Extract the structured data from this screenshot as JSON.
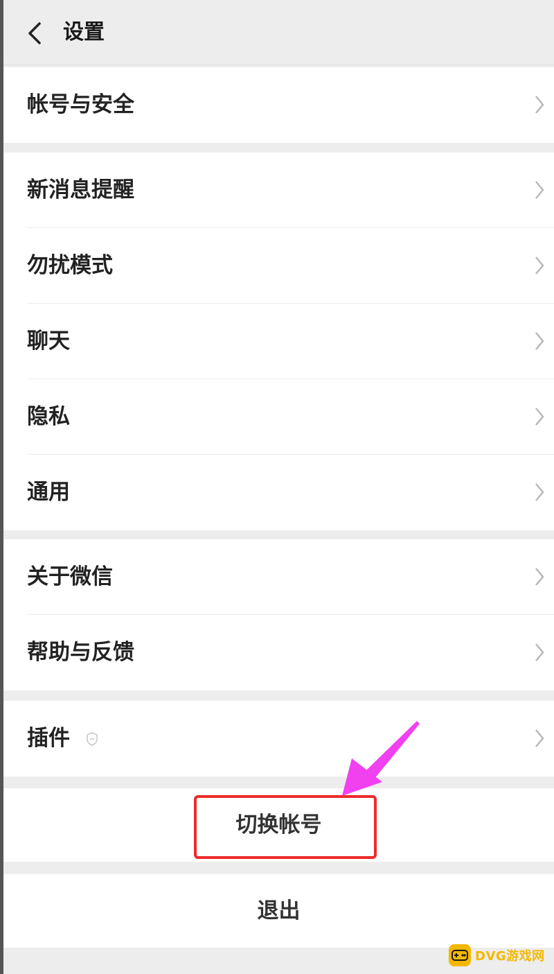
{
  "header": {
    "title": "设置"
  },
  "groups": [
    {
      "items": [
        {
          "label": "帐号与安全"
        }
      ]
    },
    {
      "items": [
        {
          "label": "新消息提醒"
        },
        {
          "label": "勿扰模式"
        },
        {
          "label": "聊天"
        },
        {
          "label": "隐私"
        },
        {
          "label": "通用"
        }
      ]
    },
    {
      "items": [
        {
          "label": "关于微信"
        },
        {
          "label": "帮助与反馈"
        }
      ]
    },
    {
      "items": [
        {
          "label": "插件"
        }
      ]
    }
  ],
  "actions": {
    "switch_account": "切换帐号",
    "logout": "退出"
  },
  "annotation": {
    "highlight_color": "#ee2a2a",
    "arrow_color": "#f040f0"
  },
  "watermark": {
    "text": "DVG游戏网"
  }
}
